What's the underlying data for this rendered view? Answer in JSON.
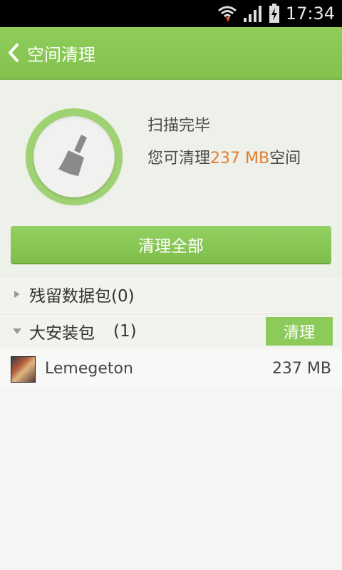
{
  "status_bar": {
    "time": "17:34",
    "icons": [
      "wifi-icon",
      "signal-icon",
      "battery-charging-icon"
    ]
  },
  "header": {
    "title": "空间清理",
    "back_icon": "chevron-left-icon",
    "color": "#88c653"
  },
  "summary": {
    "icon": "broom-icon",
    "status": "扫描完毕",
    "clean_prefix": "您可清理",
    "clean_size": "237 MB",
    "clean_suffix": "空间",
    "accent_color": "#e27b2e"
  },
  "clean_all_button": "清理全部",
  "groups": [
    {
      "label": "残留数据包(0)",
      "expanded": false
    },
    {
      "label": "大安装包",
      "count": "(1)",
      "expanded": true,
      "clean_button": "清理"
    }
  ],
  "apps": [
    {
      "name": "Lemegeton",
      "size": "237 MB",
      "icon": "app-thumbnail-icon"
    }
  ]
}
